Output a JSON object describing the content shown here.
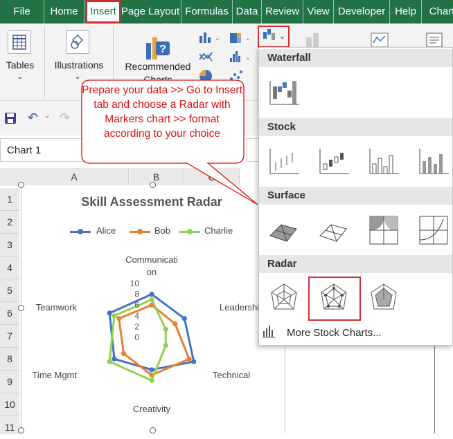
{
  "menu": {
    "tabs": [
      "File",
      "Home",
      "Insert",
      "Page Layout",
      "Formulas",
      "Data",
      "Review",
      "View",
      "Developer",
      "Help",
      "Chart"
    ],
    "active": "Insert"
  },
  "ribbon": {
    "tables_label": "Tables",
    "illustrations_label": "Illustrations",
    "recommended_label_1": "Recommended",
    "recommended_label_2": "Charts"
  },
  "name_box": {
    "value": "Chart 1"
  },
  "columns": [
    "A",
    "B",
    "C"
  ],
  "rows": [
    "1",
    "2",
    "3",
    "4",
    "5",
    "6",
    "7",
    "8",
    "9",
    "10",
    "11"
  ],
  "callout": {
    "text": "Prepare your data >> Go to Insert tab and choose a Radar with Markers chart >> format according to your choice"
  },
  "dropdown": {
    "sections": [
      "Waterfall",
      "Stock",
      "Surface",
      "Radar"
    ],
    "more_link": "More Stock Charts..."
  },
  "chart_data": {
    "type": "radar",
    "title": "Skill Assessment Radar",
    "categories": [
      "Communication",
      "Leadership",
      "Technical",
      "Creativity",
      "Time Mgmt",
      "Teamwork"
    ],
    "category_labels": [
      "Communicati",
      "on",
      "Leadership",
      "Technical",
      "Creativity",
      "Time Mgmt",
      "Teamwork"
    ],
    "axis_ticks": [
      "0",
      "2",
      "4",
      "6",
      "8",
      "10"
    ],
    "rlim": [
      0,
      10
    ],
    "legend_position": "top",
    "series": [
      {
        "name": "Alice",
        "color": "#4472C4",
        "values": [
          8,
          7,
          9,
          6,
          8,
          9
        ]
      },
      {
        "name": "Bob",
        "color": "#ED7D31",
        "values": [
          6,
          5,
          8,
          7,
          6,
          7
        ]
      },
      {
        "name": "Charlie",
        "color": "#92D050",
        "values": [
          7,
          3,
          3,
          8,
          9,
          8
        ]
      }
    ]
  },
  "colors": {
    "excel_green": "#217346",
    "highlight_red": "#d32f2f",
    "callout_text": "#e01010"
  }
}
